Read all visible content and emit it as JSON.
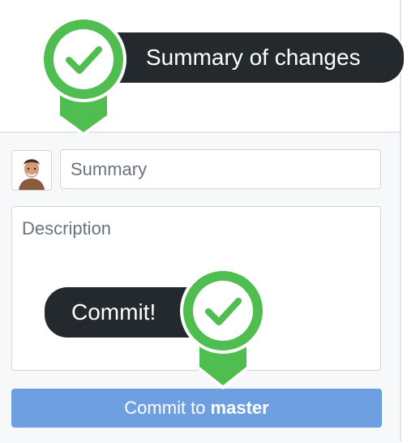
{
  "commit_form": {
    "summary_placeholder": "Summary",
    "description_placeholder": "Description",
    "button_prefix": "Commit to",
    "button_branch": "master"
  },
  "callouts": {
    "top": "Summary of changes",
    "bottom": "Commit!"
  },
  "icons": {
    "marker": "check-icon",
    "avatar": "user-avatar"
  },
  "colors": {
    "marker_green": "#4fbd4f",
    "button_blue": "#6e9fe0",
    "tooltip_dark": "#24292e"
  }
}
